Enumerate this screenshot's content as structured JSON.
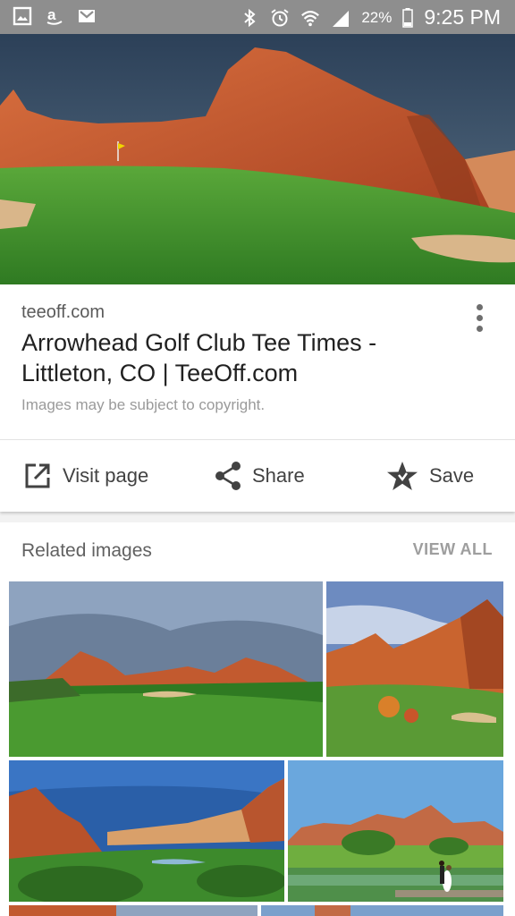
{
  "status_bar": {
    "battery": "22%",
    "time": "9:25 PM"
  },
  "result": {
    "domain": "teeoff.com",
    "title": "Arrowhead Golf Club Tee Times - Littleton, CO | TeeOff.com",
    "copyright": "Images may be subject to copyright."
  },
  "actions": {
    "visit": "Visit page",
    "share": "Share",
    "save": "Save"
  },
  "related": {
    "title": "Related images",
    "view_all": "VIEW ALL"
  },
  "colors": {
    "rock": "#c4582e",
    "grass": "#3f8f2c",
    "sky": "#3a5a7a"
  }
}
